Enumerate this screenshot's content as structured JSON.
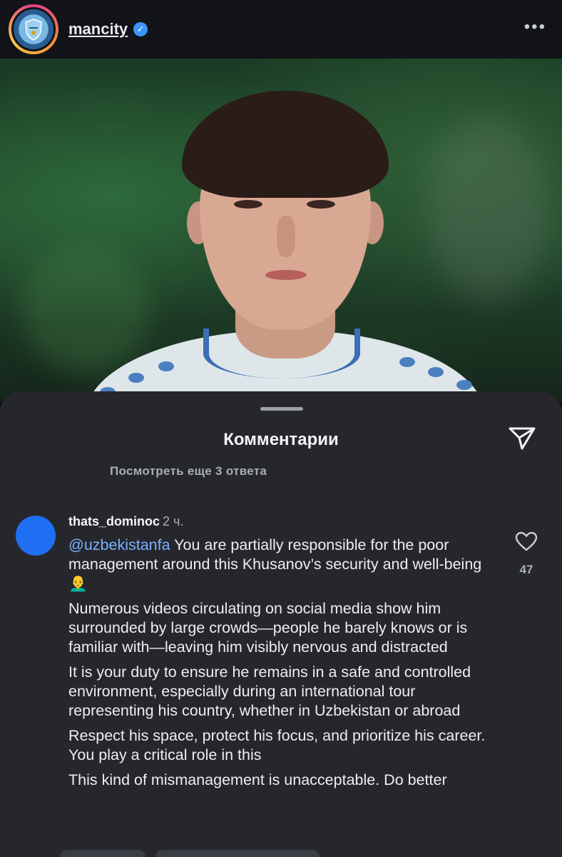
{
  "header": {
    "username": "mancity",
    "verified": true,
    "avatar_text": "MANCHESTER CITY",
    "more_icon": "more-horizontal-icon"
  },
  "photo": {
    "description_icon": "post-photo"
  },
  "comments_sheet": {
    "title": "Комментарии",
    "share_icon": "send-icon",
    "view_more": "Посмотреть еще 3 ответа",
    "comment": {
      "username": "thats_dominoc",
      "time": "2 ч.",
      "mention": "@uzbekistanfa",
      "paragraphs": [
        " You are partially responsible for the poor management around this Khusanov’s security and well-being👨‍🦲",
        "Numerous videos circulating on social media show him surrounded by large crowds—people he barely knows or is familiar with—leaving him visibly nervous and distracted",
        "It is your duty to ensure he remains in a safe and controlled environment, especially during an international tour representing his country, whether in Uzbekistan or abroad",
        "Respect his space, protect his focus, and prioritize his career. You play a critical role in this",
        "This kind of mismanagement is unacceptable. Do better"
      ],
      "like_icon": "heart-icon",
      "like_count": "47"
    }
  },
  "colors": {
    "background": "#25272c",
    "mention": "#7ab0ff",
    "verified": "#3b95f6",
    "avatar": "#1f6ff2"
  }
}
